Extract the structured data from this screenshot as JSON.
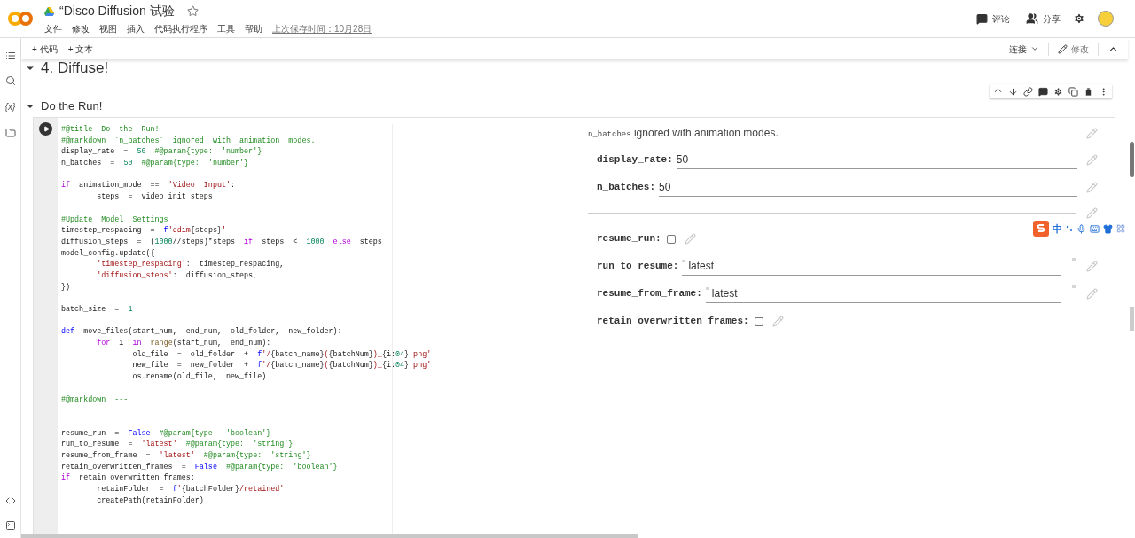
{
  "header": {
    "title": "“Disco Diffusion 试验",
    "menu": [
      "文件",
      "修改",
      "视图",
      "插入",
      "代码执行程序",
      "工具",
      "帮助"
    ],
    "last_saved": "上次保存时间：10月28日",
    "comment": "评论",
    "share": "分享"
  },
  "toolbar": {
    "add_code": "+ 代码",
    "add_text": "+ 文本",
    "connect": "连接",
    "edit": "修改"
  },
  "section": {
    "title": "4. Diffuse!",
    "expanded": true
  },
  "cell": {
    "title": "Do the Run!",
    "expanded": true,
    "code": [
      {
        "kind": "code",
        "segments": [
          {
            "kind": "comment",
            "text": "#@title  Do  the  Run!"
          }
        ]
      },
      {
        "kind": "code",
        "segments": [
          {
            "kind": "comment",
            "text": "#@markdown  `n_batches`  ignored  with  animation  modes."
          }
        ]
      },
      {
        "kind": "code",
        "segments": [
          {
            "kind": "plain",
            "text": "display_rate  =  "
          },
          {
            "kind": "number",
            "text": "50"
          },
          {
            "kind": "comment",
            "text": "  #@param{type:  'number'}"
          }
        ]
      },
      {
        "kind": "code",
        "segments": [
          {
            "kind": "plain",
            "text": "n_batches  =  "
          },
          {
            "kind": "number",
            "text": "50"
          },
          {
            "kind": "comment",
            "text": "  #@param{type:  'number'}"
          }
        ]
      },
      {
        "kind": "blank"
      },
      {
        "kind": "code",
        "segments": [
          {
            "kind": "control",
            "text": "if"
          },
          {
            "kind": "plain",
            "text": "  animation_mode  ==  "
          },
          {
            "kind": "string",
            "text": "'Video  Input'"
          },
          {
            "kind": "plain",
            "text": ":"
          }
        ]
      },
      {
        "kind": "code",
        "segments": [
          {
            "kind": "plain",
            "text": "        steps  =  video_init_steps"
          }
        ]
      },
      {
        "kind": "blank"
      },
      {
        "kind": "code",
        "segments": [
          {
            "kind": "comment",
            "text": "#Update  Model  Settings"
          }
        ]
      },
      {
        "kind": "code",
        "segments": [
          {
            "kind": "plain",
            "text": "timestep_respacing  =  "
          },
          {
            "kind": "keyword",
            "text": "f"
          },
          {
            "kind": "string",
            "text": "'ddim"
          },
          {
            "kind": "plain",
            "text": "{steps}"
          },
          {
            "kind": "string",
            "text": "'"
          }
        ]
      },
      {
        "kind": "code",
        "segments": [
          {
            "kind": "plain",
            "text": "diffusion_steps  =  ("
          },
          {
            "kind": "number",
            "text": "1000"
          },
          {
            "kind": "plain",
            "text": "//steps)*steps  "
          },
          {
            "kind": "control",
            "text": "if"
          },
          {
            "kind": "plain",
            "text": "  steps  <  "
          },
          {
            "kind": "number",
            "text": "1000"
          },
          {
            "kind": "control",
            "text": "  else"
          },
          {
            "kind": "plain",
            "text": "  steps"
          }
        ]
      },
      {
        "kind": "code",
        "segments": [
          {
            "kind": "plain",
            "text": "model_config.update({"
          }
        ]
      },
      {
        "kind": "code",
        "segments": [
          {
            "kind": "string",
            "text": "        'timestep_respacing'"
          },
          {
            "kind": "plain",
            "text": ":  timestep_respacing,"
          }
        ]
      },
      {
        "kind": "code",
        "segments": [
          {
            "kind": "string",
            "text": "        'diffusion_steps'"
          },
          {
            "kind": "plain",
            "text": ":  diffusion_steps,"
          }
        ]
      },
      {
        "kind": "code",
        "segments": [
          {
            "kind": "plain",
            "text": "})"
          }
        ]
      },
      {
        "kind": "blank"
      },
      {
        "kind": "code",
        "segments": [
          {
            "kind": "plain",
            "text": "batch_size  =  "
          },
          {
            "kind": "number",
            "text": "1"
          }
        ]
      },
      {
        "kind": "blank"
      },
      {
        "kind": "code",
        "segments": [
          {
            "kind": "keyword",
            "text": "def"
          },
          {
            "kind": "plain",
            "text": "  move_files(start_num,  end_num,  old_folder,  new_folder):"
          }
        ]
      },
      {
        "kind": "code",
        "segments": [
          {
            "kind": "control",
            "text": "        for"
          },
          {
            "kind": "plain",
            "text": "  i  "
          },
          {
            "kind": "control",
            "text": "in"
          },
          {
            "kind": "builtin",
            "text": "  range"
          },
          {
            "kind": "plain",
            "text": "(start_num,  end_num):"
          }
        ]
      },
      {
        "kind": "code",
        "segments": [
          {
            "kind": "plain",
            "text": "                old_file  =  old_folder  +  "
          },
          {
            "kind": "keyword",
            "text": "f"
          },
          {
            "kind": "string",
            "text": "'/"
          },
          {
            "kind": "plain",
            "text": "{batch_name}"
          },
          {
            "kind": "string",
            "text": "("
          },
          {
            "kind": "plain",
            "text": "{batchNum}"
          },
          {
            "kind": "string",
            "text": ")_"
          },
          {
            "kind": "plain",
            "text": "{i:"
          },
          {
            "kind": "number",
            "text": "04"
          },
          {
            "kind": "plain",
            "text": "}"
          },
          {
            "kind": "string",
            "text": ".png'"
          }
        ]
      },
      {
        "kind": "code",
        "segments": [
          {
            "kind": "plain",
            "text": "                new_file  =  new_folder  +  "
          },
          {
            "kind": "keyword",
            "text": "f"
          },
          {
            "kind": "string",
            "text": "'/"
          },
          {
            "kind": "plain",
            "text": "{batch_name}"
          },
          {
            "kind": "string",
            "text": "("
          },
          {
            "kind": "plain",
            "text": "{batchNum}"
          },
          {
            "kind": "string",
            "text": ")_"
          },
          {
            "kind": "plain",
            "text": "{i:"
          },
          {
            "kind": "number",
            "text": "04"
          },
          {
            "kind": "plain",
            "text": "}"
          },
          {
            "kind": "string",
            "text": ".png'"
          }
        ]
      },
      {
        "kind": "code",
        "segments": [
          {
            "kind": "plain",
            "text": "                os.rename(old_file,  new_file)"
          }
        ]
      },
      {
        "kind": "blank"
      },
      {
        "kind": "code",
        "segments": [
          {
            "kind": "comment",
            "text": "#@markdown  ---"
          }
        ]
      },
      {
        "kind": "blank"
      },
      {
        "kind": "blank"
      },
      {
        "kind": "code",
        "segments": [
          {
            "kind": "plain",
            "text": "resume_run  =  "
          },
          {
            "kind": "keyword",
            "text": "False"
          },
          {
            "kind": "comment",
            "text": "  #@param{type:  'boolean'}"
          }
        ]
      },
      {
        "kind": "code",
        "segments": [
          {
            "kind": "plain",
            "text": "run_to_resume  =  "
          },
          {
            "kind": "string",
            "text": "'latest'"
          },
          {
            "kind": "comment",
            "text": "  #@param{type:  'string'}"
          }
        ]
      },
      {
        "kind": "code",
        "segments": [
          {
            "kind": "plain",
            "text": "resume_from_frame  =  "
          },
          {
            "kind": "string",
            "text": "'latest'"
          },
          {
            "kind": "comment",
            "text": "  #@param{type:  'string'}"
          }
        ]
      },
      {
        "kind": "code",
        "segments": [
          {
            "kind": "plain",
            "text": "retain_overwritten_frames  =  "
          },
          {
            "kind": "keyword",
            "text": "False"
          },
          {
            "kind": "comment",
            "text": "  #@param{type:  'boolean'}"
          }
        ]
      },
      {
        "kind": "code",
        "segments": [
          {
            "kind": "control",
            "text": "if"
          },
          {
            "kind": "plain",
            "text": "  retain_overwritten_frames:"
          }
        ]
      },
      {
        "kind": "code",
        "segments": [
          {
            "kind": "plain",
            "text": "        retainFolder  =  "
          },
          {
            "kind": "keyword",
            "text": "f"
          },
          {
            "kind": "string",
            "text": "'"
          },
          {
            "kind": "plain",
            "text": "{batchFolder}"
          },
          {
            "kind": "string",
            "text": "/retained'"
          }
        ]
      },
      {
        "kind": "code",
        "segments": [
          {
            "kind": "plain",
            "text": "        createPath(retainFolder)"
          }
        ]
      }
    ],
    "form": [
      {
        "kind": "markdown",
        "code": "n_batches",
        "text": "ignored with animation modes."
      },
      {
        "kind": "number",
        "label": "display_rate:",
        "value": "50"
      },
      {
        "kind": "number",
        "label": "n_batches:",
        "value": "50"
      },
      {
        "kind": "rule"
      },
      {
        "kind": "checkbox",
        "label": "resume_run:",
        "checked": false
      },
      {
        "kind": "string",
        "label": "run_to_resume:",
        "value": "latest"
      },
      {
        "kind": "string",
        "label": "resume_from_frame:",
        "value": "latest"
      },
      {
        "kind": "checkbox",
        "label": "retain_overwritten_frames:",
        "checked": false
      }
    ]
  },
  "ime_toolbar": {
    "mode": "中"
  },
  "sidebar": {
    "variables": "{x}"
  }
}
